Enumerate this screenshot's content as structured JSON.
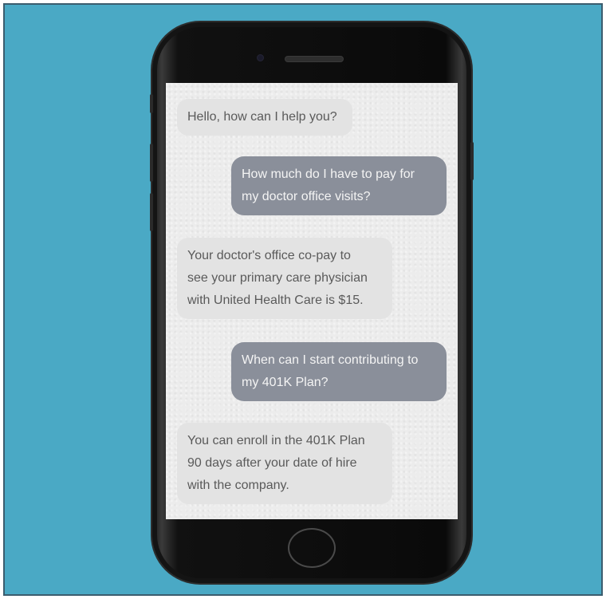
{
  "chat": {
    "messages": [
      {
        "role": "bot",
        "text": "Hello, how can I help you?"
      },
      {
        "role": "user",
        "text": "How much do I have to pay for\nmy doctor office visits?"
      },
      {
        "role": "bot",
        "text": "Your doctor's office co-pay to\nsee your primary care physician\nwith United Health Care is $15."
      },
      {
        "role": "user",
        "text": "When can I start contributing to\nmy 401K Plan?"
      },
      {
        "role": "bot",
        "text": "You can enroll in the 401K Plan\n90 days after your date of hire\nwith the company."
      }
    ]
  },
  "colors": {
    "background": "#4aa9c5",
    "bot_bubble": "#e3e3e3",
    "user_bubble": "#8a8f9a"
  }
}
